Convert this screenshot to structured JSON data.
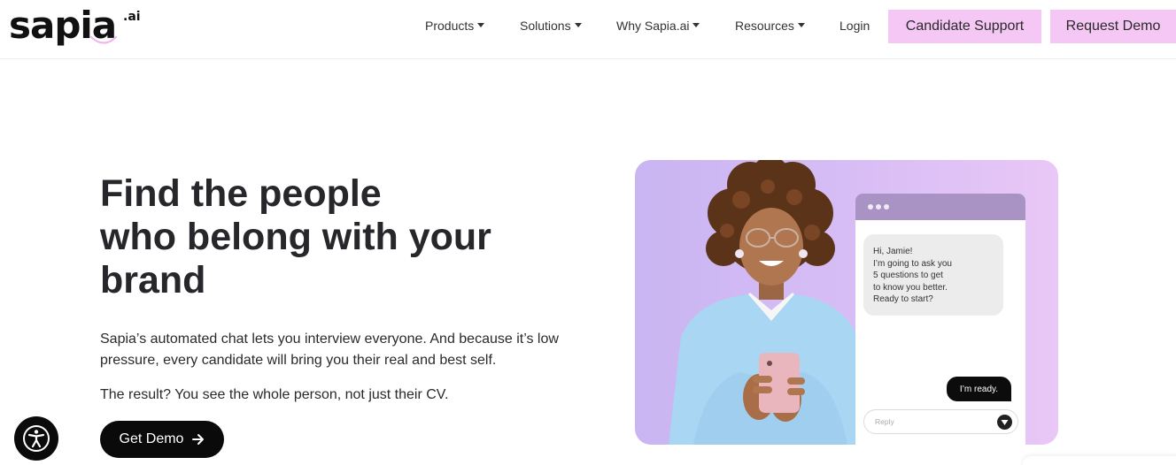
{
  "brand": {
    "logo_text": "sapia",
    "logo_suffix": ".ai",
    "accent_pink": "#f4c7f4",
    "dark": "#0a0a0a"
  },
  "nav": {
    "items": [
      {
        "label": "Products",
        "has_caret": true
      },
      {
        "label": "Solutions",
        "has_caret": true
      },
      {
        "label": "Why Sapia.ai",
        "has_caret": true
      },
      {
        "label": "Resources",
        "has_caret": true
      },
      {
        "label": "Login",
        "has_caret": false
      }
    ],
    "candidate_support": "Candidate Support",
    "request_demo": "Request Demo"
  },
  "hero": {
    "title_lines": [
      "Find the people",
      "who belong with your",
      "brand"
    ],
    "paragraph_1": "Sapia’s automated chat lets you interview everyone. And because it’s low pressure, every candidate will bring you their real and best self.",
    "paragraph_2": "The result? You see the whole person, not just their CV.",
    "cta_label": "Get Demo"
  },
  "chat": {
    "incoming": "Hi, Jamie!\nI’m going to ask you\n5 questions to get\nto know you better.\nReady to start?",
    "outgoing": "I’m ready.",
    "reply_placeholder": "Reply"
  },
  "icons": {
    "accessibility": "accessibility-icon",
    "arrow": "arrow-right-icon",
    "send": "send-icon",
    "caret": "caret-down-icon"
  }
}
